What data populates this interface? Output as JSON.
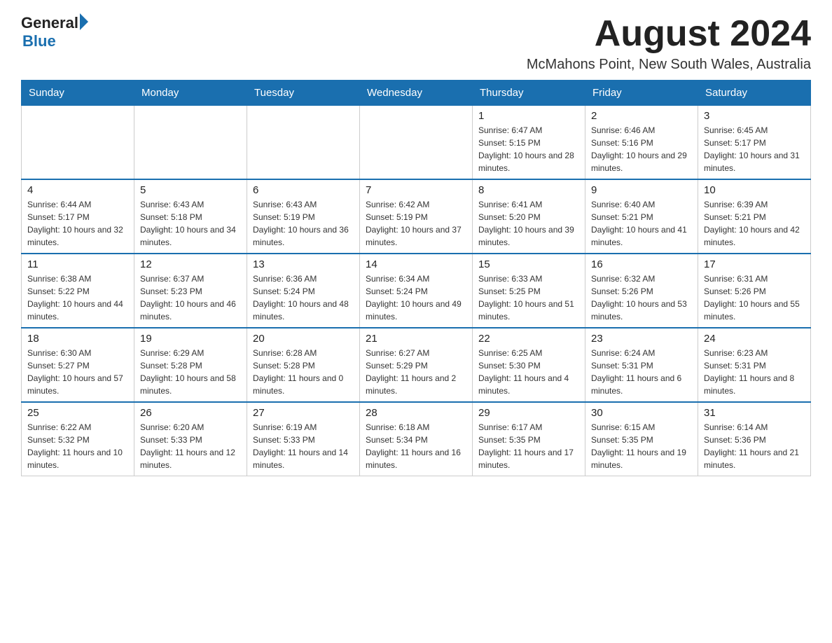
{
  "header": {
    "logo_general": "General",
    "logo_blue": "Blue",
    "month_title": "August 2024",
    "subtitle": "McMahons Point, New South Wales, Australia"
  },
  "weekdays": [
    "Sunday",
    "Monday",
    "Tuesday",
    "Wednesday",
    "Thursday",
    "Friday",
    "Saturday"
  ],
  "weeks": [
    [
      {
        "day": "",
        "info": ""
      },
      {
        "day": "",
        "info": ""
      },
      {
        "day": "",
        "info": ""
      },
      {
        "day": "",
        "info": ""
      },
      {
        "day": "1",
        "info": "Sunrise: 6:47 AM\nSunset: 5:15 PM\nDaylight: 10 hours and 28 minutes."
      },
      {
        "day": "2",
        "info": "Sunrise: 6:46 AM\nSunset: 5:16 PM\nDaylight: 10 hours and 29 minutes."
      },
      {
        "day": "3",
        "info": "Sunrise: 6:45 AM\nSunset: 5:17 PM\nDaylight: 10 hours and 31 minutes."
      }
    ],
    [
      {
        "day": "4",
        "info": "Sunrise: 6:44 AM\nSunset: 5:17 PM\nDaylight: 10 hours and 32 minutes."
      },
      {
        "day": "5",
        "info": "Sunrise: 6:43 AM\nSunset: 5:18 PM\nDaylight: 10 hours and 34 minutes."
      },
      {
        "day": "6",
        "info": "Sunrise: 6:43 AM\nSunset: 5:19 PM\nDaylight: 10 hours and 36 minutes."
      },
      {
        "day": "7",
        "info": "Sunrise: 6:42 AM\nSunset: 5:19 PM\nDaylight: 10 hours and 37 minutes."
      },
      {
        "day": "8",
        "info": "Sunrise: 6:41 AM\nSunset: 5:20 PM\nDaylight: 10 hours and 39 minutes."
      },
      {
        "day": "9",
        "info": "Sunrise: 6:40 AM\nSunset: 5:21 PM\nDaylight: 10 hours and 41 minutes."
      },
      {
        "day": "10",
        "info": "Sunrise: 6:39 AM\nSunset: 5:21 PM\nDaylight: 10 hours and 42 minutes."
      }
    ],
    [
      {
        "day": "11",
        "info": "Sunrise: 6:38 AM\nSunset: 5:22 PM\nDaylight: 10 hours and 44 minutes."
      },
      {
        "day": "12",
        "info": "Sunrise: 6:37 AM\nSunset: 5:23 PM\nDaylight: 10 hours and 46 minutes."
      },
      {
        "day": "13",
        "info": "Sunrise: 6:36 AM\nSunset: 5:24 PM\nDaylight: 10 hours and 48 minutes."
      },
      {
        "day": "14",
        "info": "Sunrise: 6:34 AM\nSunset: 5:24 PM\nDaylight: 10 hours and 49 minutes."
      },
      {
        "day": "15",
        "info": "Sunrise: 6:33 AM\nSunset: 5:25 PM\nDaylight: 10 hours and 51 minutes."
      },
      {
        "day": "16",
        "info": "Sunrise: 6:32 AM\nSunset: 5:26 PM\nDaylight: 10 hours and 53 minutes."
      },
      {
        "day": "17",
        "info": "Sunrise: 6:31 AM\nSunset: 5:26 PM\nDaylight: 10 hours and 55 minutes."
      }
    ],
    [
      {
        "day": "18",
        "info": "Sunrise: 6:30 AM\nSunset: 5:27 PM\nDaylight: 10 hours and 57 minutes."
      },
      {
        "day": "19",
        "info": "Sunrise: 6:29 AM\nSunset: 5:28 PM\nDaylight: 10 hours and 58 minutes."
      },
      {
        "day": "20",
        "info": "Sunrise: 6:28 AM\nSunset: 5:28 PM\nDaylight: 11 hours and 0 minutes."
      },
      {
        "day": "21",
        "info": "Sunrise: 6:27 AM\nSunset: 5:29 PM\nDaylight: 11 hours and 2 minutes."
      },
      {
        "day": "22",
        "info": "Sunrise: 6:25 AM\nSunset: 5:30 PM\nDaylight: 11 hours and 4 minutes."
      },
      {
        "day": "23",
        "info": "Sunrise: 6:24 AM\nSunset: 5:31 PM\nDaylight: 11 hours and 6 minutes."
      },
      {
        "day": "24",
        "info": "Sunrise: 6:23 AM\nSunset: 5:31 PM\nDaylight: 11 hours and 8 minutes."
      }
    ],
    [
      {
        "day": "25",
        "info": "Sunrise: 6:22 AM\nSunset: 5:32 PM\nDaylight: 11 hours and 10 minutes."
      },
      {
        "day": "26",
        "info": "Sunrise: 6:20 AM\nSunset: 5:33 PM\nDaylight: 11 hours and 12 minutes."
      },
      {
        "day": "27",
        "info": "Sunrise: 6:19 AM\nSunset: 5:33 PM\nDaylight: 11 hours and 14 minutes."
      },
      {
        "day": "28",
        "info": "Sunrise: 6:18 AM\nSunset: 5:34 PM\nDaylight: 11 hours and 16 minutes."
      },
      {
        "day": "29",
        "info": "Sunrise: 6:17 AM\nSunset: 5:35 PM\nDaylight: 11 hours and 17 minutes."
      },
      {
        "day": "30",
        "info": "Sunrise: 6:15 AM\nSunset: 5:35 PM\nDaylight: 11 hours and 19 minutes."
      },
      {
        "day": "31",
        "info": "Sunrise: 6:14 AM\nSunset: 5:36 PM\nDaylight: 11 hours and 21 minutes."
      }
    ]
  ]
}
